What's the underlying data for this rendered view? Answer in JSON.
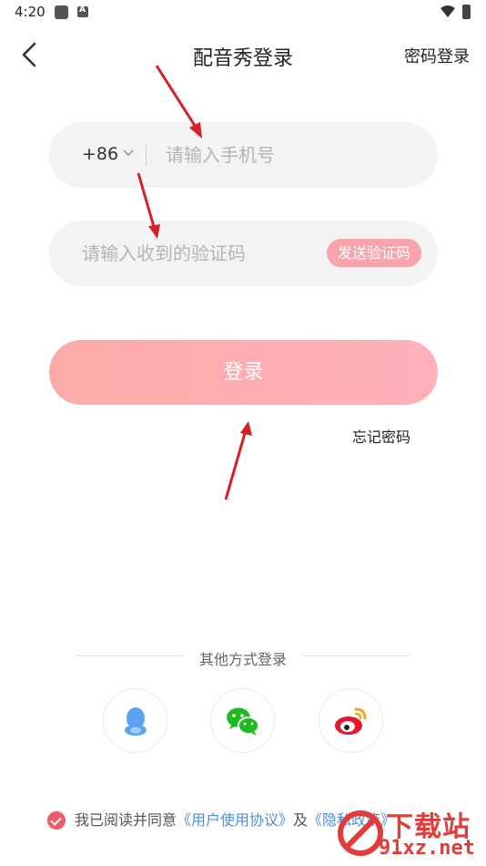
{
  "status_bar": {
    "time": "4:20"
  },
  "header": {
    "title": "配音秀登录",
    "password_login": "密码登录"
  },
  "phone_field": {
    "country_code": "+86",
    "placeholder": "请输入手机号"
  },
  "code_field": {
    "placeholder": "请输入收到的验证码",
    "send_code_label": "发送验证码"
  },
  "login_button": {
    "label": "登录"
  },
  "forgot_password": "忘记密码",
  "other_login": {
    "label": "其他方式登录",
    "options": [
      "qq-icon",
      "wechat-icon",
      "weibo-icon"
    ]
  },
  "agreement": {
    "prefix": "我已阅读并同意",
    "user_agreement": "《用户使用协议》",
    "and": "及",
    "privacy_policy": "《隐私政策》"
  },
  "watermark": {
    "line1": "下载站",
    "line2": "91xz.net"
  },
  "colors": {
    "accent": "#f05a69",
    "button": "#ffb0b9",
    "link": "#4a90d9",
    "annotation_arrow": "#d61f26"
  }
}
